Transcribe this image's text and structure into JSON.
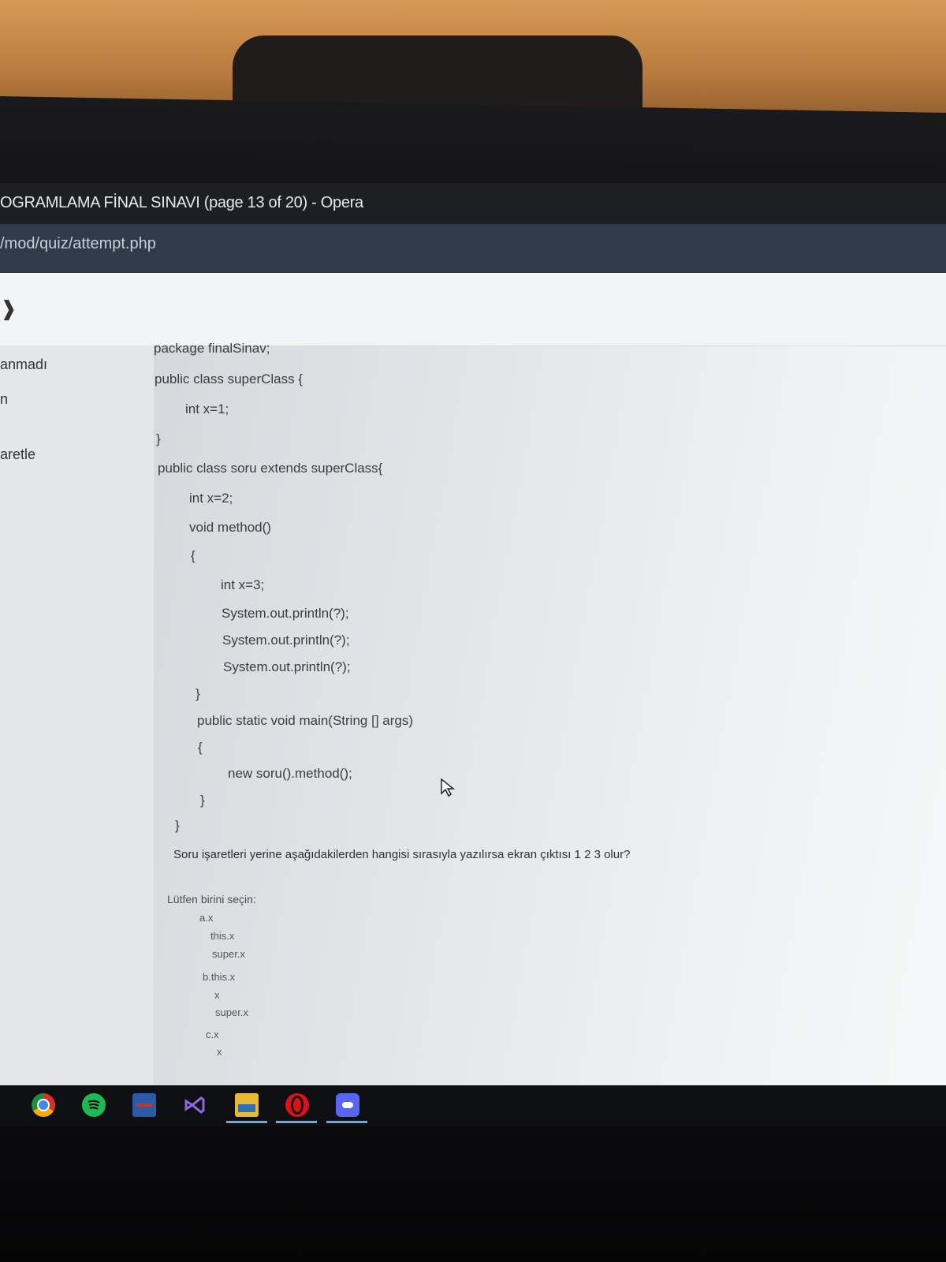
{
  "window": {
    "title": "OGRAMLAMA FİNAL SINAVI (page 13 of 20) - Opera"
  },
  "address_bar": {
    "url": "/mod/quiz/attempt.php"
  },
  "header": {
    "icon": "expand-icon"
  },
  "sidebar": {
    "items": [
      {
        "label": "anmadı"
      },
      {
        "label": "n"
      },
      {
        "label": "aretle"
      }
    ]
  },
  "code": {
    "lines": [
      "package finalSinav;",
      "public class superClass {",
      "int x=1;",
      "}",
      "public class soru extends superClass{",
      "int x=2;",
      "void method()",
      "{",
      "int x=3;",
      "System.out.println(?);",
      "System.out.println(?);",
      "System.out.println(?);",
      "}",
      "public static void main(String [] args)",
      "{",
      "new soru().method();",
      "}",
      "}"
    ]
  },
  "question": {
    "text": "Soru işaretleri yerine aşağıdakilerden hangisi sırasıyla yazılırsa ekran çıktısı 1 2 3 olur?",
    "prompt": "Lütfen birini seçin:",
    "options": [
      {
        "lines": [
          "a.x",
          "this.x",
          "super.x"
        ]
      },
      {
        "lines": [
          "b.this.x",
          "x",
          "super.x"
        ]
      },
      {
        "lines": [
          "c.x",
          "x"
        ]
      }
    ]
  },
  "taskbar": {
    "icons": [
      "chrome-icon",
      "spotify-icon",
      "app-icon",
      "visual-studio-icon",
      "file-explorer-icon",
      "opera-icon",
      "discord-icon"
    ]
  }
}
